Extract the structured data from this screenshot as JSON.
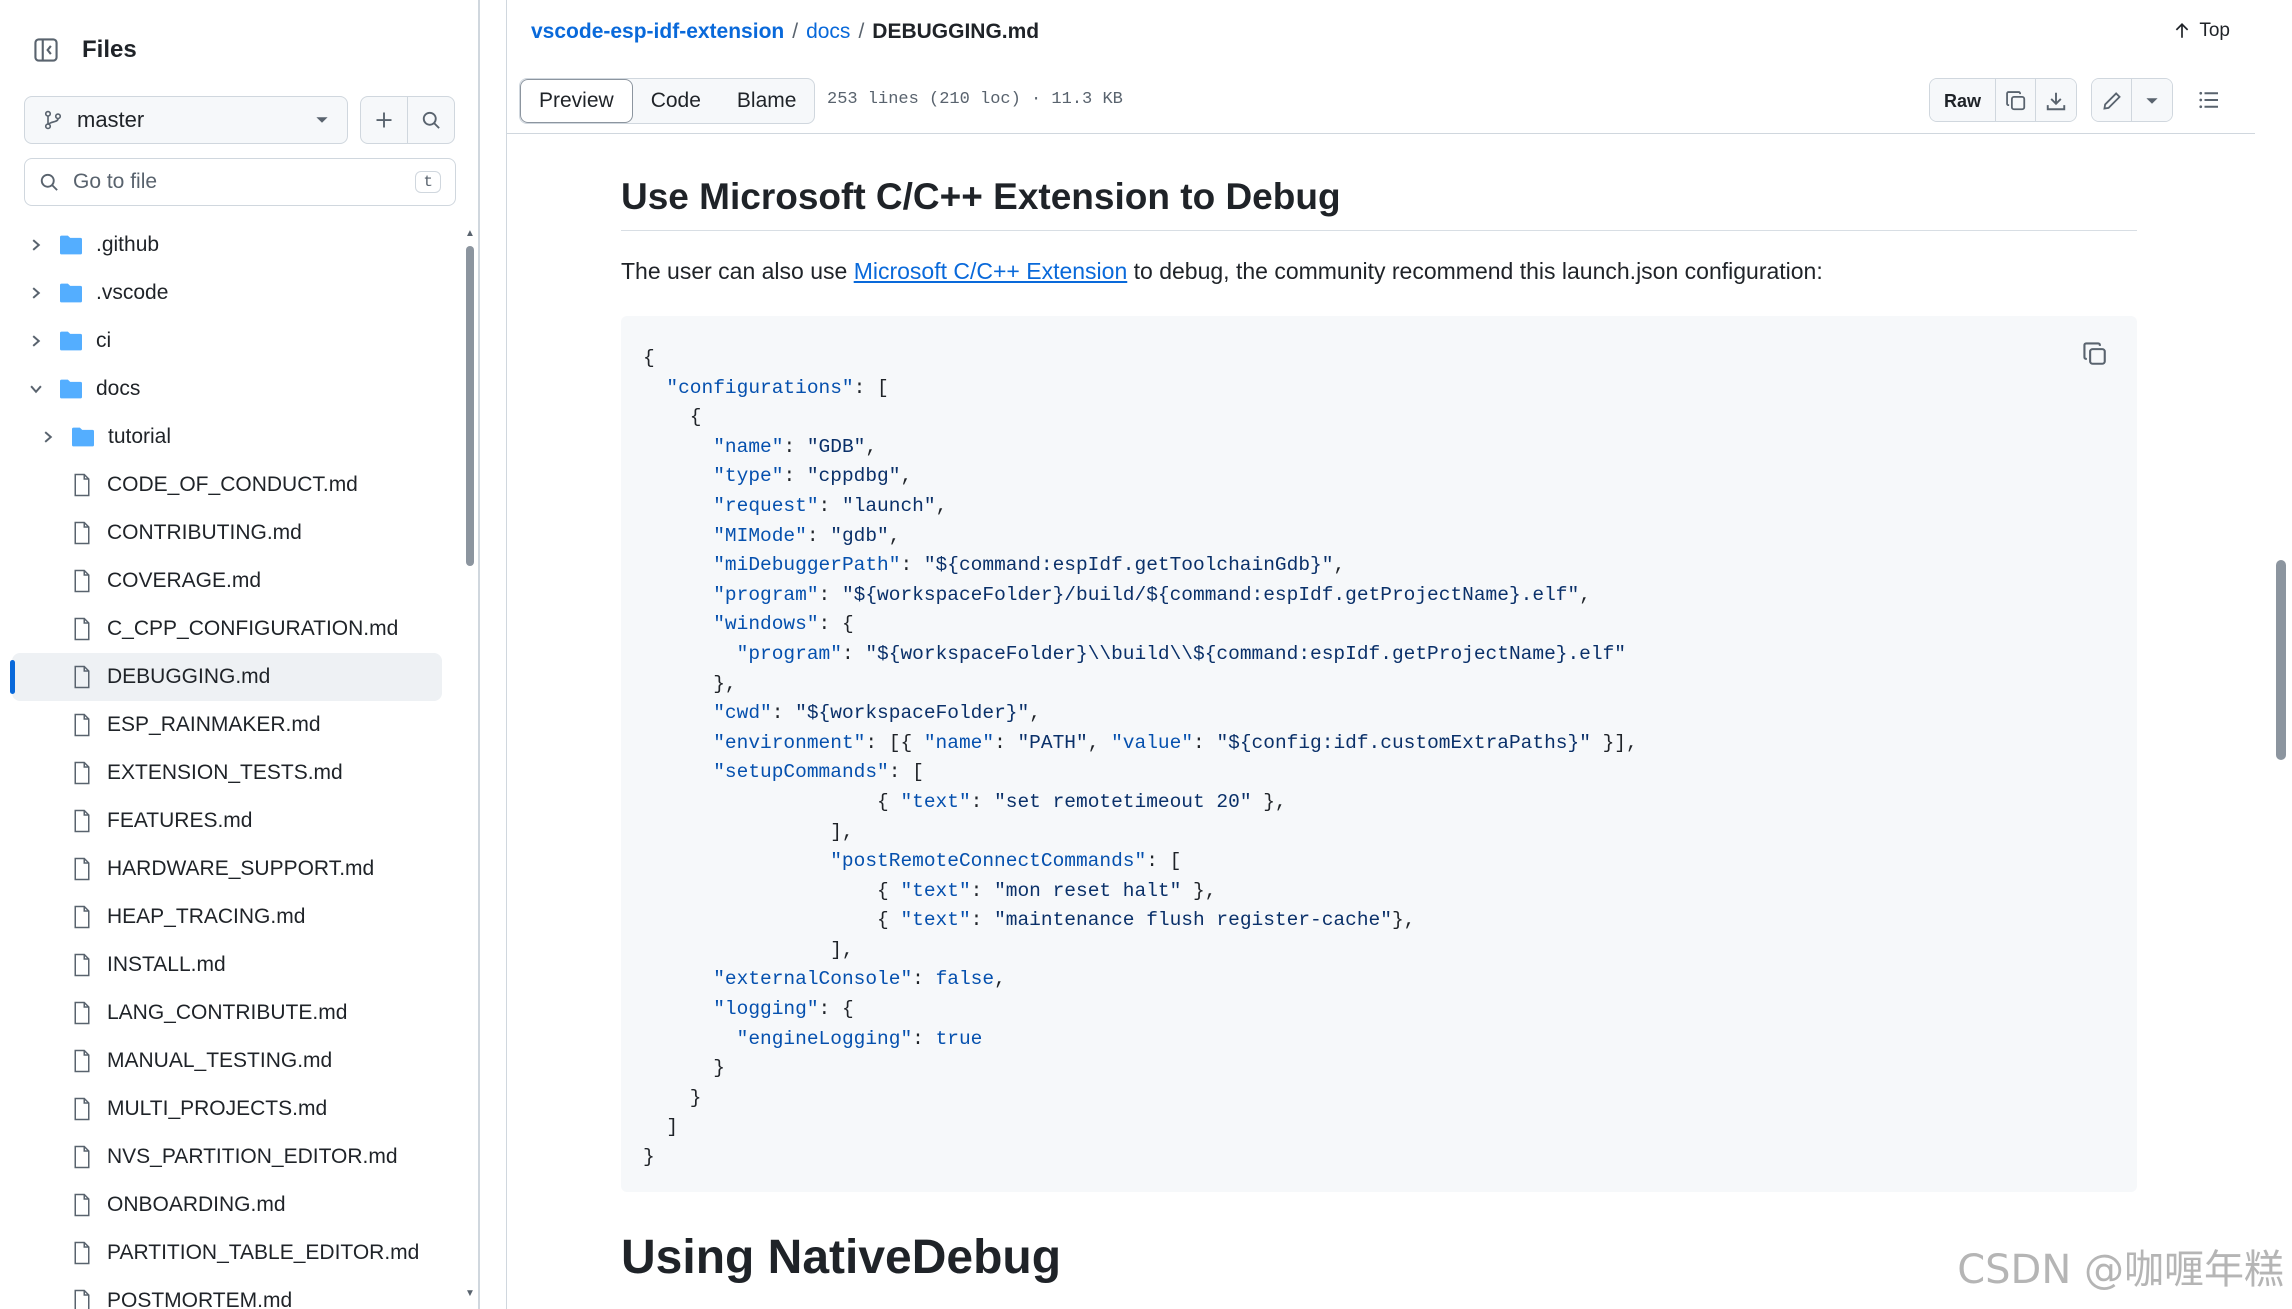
{
  "sidebar": {
    "title": "Files",
    "branch": "master",
    "search_placeholder": "Go to file",
    "search_shortcut": "t",
    "tree": [
      {
        "name": ".github",
        "type": "folder",
        "level": 0,
        "expanded": false
      },
      {
        "name": ".vscode",
        "type": "folder",
        "level": 0,
        "expanded": false
      },
      {
        "name": "ci",
        "type": "folder",
        "level": 0,
        "expanded": false
      },
      {
        "name": "docs",
        "type": "folder",
        "level": 0,
        "expanded": true
      },
      {
        "name": "tutorial",
        "type": "folder",
        "level": 1,
        "expanded": false
      },
      {
        "name": "CODE_OF_CONDUCT.md",
        "type": "file",
        "level": 1
      },
      {
        "name": "CONTRIBUTING.md",
        "type": "file",
        "level": 1
      },
      {
        "name": "COVERAGE.md",
        "type": "file",
        "level": 1
      },
      {
        "name": "C_CPP_CONFIGURATION.md",
        "type": "file",
        "level": 1
      },
      {
        "name": "DEBUGGING.md",
        "type": "file",
        "level": 1,
        "selected": true
      },
      {
        "name": "ESP_RAINMAKER.md",
        "type": "file",
        "level": 1
      },
      {
        "name": "EXTENSION_TESTS.md",
        "type": "file",
        "level": 1
      },
      {
        "name": "FEATURES.md",
        "type": "file",
        "level": 1
      },
      {
        "name": "HARDWARE_SUPPORT.md",
        "type": "file",
        "level": 1
      },
      {
        "name": "HEAP_TRACING.md",
        "type": "file",
        "level": 1
      },
      {
        "name": "INSTALL.md",
        "type": "file",
        "level": 1
      },
      {
        "name": "LANG_CONTRIBUTE.md",
        "type": "file",
        "level": 1
      },
      {
        "name": "MANUAL_TESTING.md",
        "type": "file",
        "level": 1
      },
      {
        "name": "MULTI_PROJECTS.md",
        "type": "file",
        "level": 1
      },
      {
        "name": "NVS_PARTITION_EDITOR.md",
        "type": "file",
        "level": 1
      },
      {
        "name": "ONBOARDING.md",
        "type": "file",
        "level": 1
      },
      {
        "name": "PARTITION_TABLE_EDITOR.md",
        "type": "file",
        "level": 1
      },
      {
        "name": "POSTMORTEM.md",
        "type": "file",
        "level": 1
      }
    ]
  },
  "header": {
    "breadcrumb": {
      "repo": "vscode-esp-idf-extension",
      "folder": "docs",
      "file": "DEBUGGING.md"
    },
    "top_label": "Top"
  },
  "toolbar": {
    "tabs": [
      "Preview",
      "Code",
      "Blame"
    ],
    "active_tab": "Preview",
    "file_meta": "253 lines (210 loc) · 11.3 KB",
    "raw_label": "Raw"
  },
  "content": {
    "heading": "Use Microsoft C/C++ Extension to Debug",
    "para_before": "The user can also use ",
    "para_link": "Microsoft C/C++ Extension",
    "para_after": " to debug, the community recommend this launch.json configuration:",
    "next_heading": "Using NativeDebug",
    "code_lines": [
      "{",
      "  \"configurations\": [",
      "    {",
      "      \"name\": \"GDB\",",
      "      \"type\": \"cppdbg\",",
      "      \"request\": \"launch\",",
      "      \"MIMode\": \"gdb\",",
      "      \"miDebuggerPath\": \"${command:espIdf.getToolchainGdb}\",",
      "      \"program\": \"${workspaceFolder}/build/${command:espIdf.getProjectName}.elf\",",
      "      \"windows\": {",
      "        \"program\": \"${workspaceFolder}\\\\build\\\\${command:espIdf.getProjectName}.elf\"",
      "      },",
      "      \"cwd\": \"${workspaceFolder}\",",
      "      \"environment\": [{ \"name\": \"PATH\", \"value\": \"${config:idf.customExtraPaths}\" }],",
      "      \"setupCommands\": [",
      "                    { \"text\": \"set remotetimeout 20\" },",
      "                ],",
      "                \"postRemoteConnectCommands\": [",
      "                    { \"text\": \"mon reset halt\" },",
      "                    { \"text\": \"maintenance flush register-cache\"},",
      "                ],",
      "      \"externalConsole\": false,",
      "      \"logging\": {",
      "        \"engineLogging\": true",
      "      }",
      "    }",
      "  ]",
      "}"
    ]
  },
  "watermark": "CSDN @咖喱年糕",
  "colors": {
    "link": "#0969da",
    "selected_bar": "#0969da",
    "code_bg": "#f6f8fa",
    "code_key": "#0550ae",
    "code_string": "#0a3069"
  }
}
